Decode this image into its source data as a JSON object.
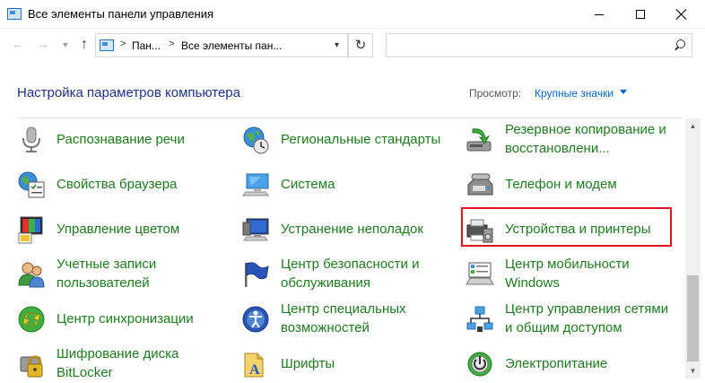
{
  "window": {
    "title": "Все элементы панели управления"
  },
  "address": {
    "crumbs": [
      "Пан...",
      "Все элементы пан..."
    ],
    "separator": ">"
  },
  "header": {
    "title": "Настройка параметров компьютера",
    "view_label": "Просмотр:",
    "view_value": "Крупные значки"
  },
  "items": [
    {
      "label": "Распознавание речи",
      "icon": "microphone-icon"
    },
    {
      "label": "Региональные стандарты",
      "icon": "globe-clock-icon"
    },
    {
      "label": "Резервное копирование и восстановлени...",
      "line1": "Резервное копирование и",
      "line2": "восстановлени...",
      "icon": "backup-restore-icon"
    },
    {
      "label": "Свойства браузера",
      "icon": "browser-properties-icon"
    },
    {
      "label": "Система",
      "icon": "computer-icon"
    },
    {
      "label": "Телефон и модем",
      "icon": "phone-modem-icon"
    },
    {
      "label": "Управление цветом",
      "icon": "color-management-icon"
    },
    {
      "label": "Устранение неполадок",
      "icon": "troubleshooting-icon"
    },
    {
      "label": "Устройства и принтеры",
      "icon": "printer-icon"
    },
    {
      "label": "Учетные записи пользователей",
      "line1": "Учетные записи",
      "line2": "пользователей",
      "icon": "users-icon"
    },
    {
      "label": "Центр безопасности и обслуживания",
      "line1": "Центр безопасности и",
      "line2": "обслуживания",
      "icon": "flag-icon"
    },
    {
      "label": "Центр мобильности Windows",
      "line1": "Центр мобильности",
      "line2": "Windows",
      "icon": "mobility-icon"
    },
    {
      "label": "Центр синхронизации",
      "icon": "sync-icon"
    },
    {
      "label": "Центр специальных возможностей",
      "line1": "Центр специальных",
      "line2": "возможностей",
      "icon": "accessibility-icon"
    },
    {
      "label": "Центр управления сетями и общим доступом",
      "line1": "Центр управления сетями",
      "line2": "и общим доступом",
      "icon": "network-icon"
    },
    {
      "label": "Шифрование диска BitLocker",
      "line1": "Шифрование диска",
      "line2": "BitLocker",
      "icon": "bitlocker-icon"
    },
    {
      "label": "Шрифты",
      "icon": "fonts-icon"
    },
    {
      "label": "Электропитание",
      "icon": "power-icon"
    }
  ],
  "highlighted_item": "Устройства и принтеры"
}
